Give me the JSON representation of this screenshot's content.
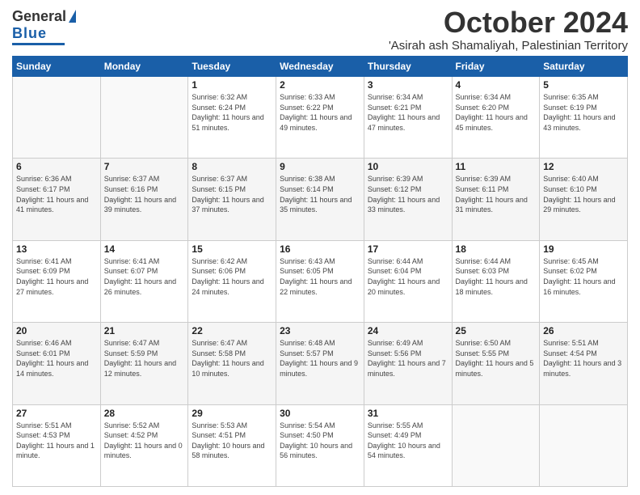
{
  "logo": {
    "line1": "General",
    "line2": "Blue"
  },
  "title": "October 2024",
  "location": "'Asirah ash Shamaliyah, Palestinian Territory",
  "days_of_week": [
    "Sunday",
    "Monday",
    "Tuesday",
    "Wednesday",
    "Thursday",
    "Friday",
    "Saturday"
  ],
  "weeks": [
    [
      {
        "day": "",
        "sunrise": "",
        "sunset": "",
        "daylight": ""
      },
      {
        "day": "",
        "sunrise": "",
        "sunset": "",
        "daylight": ""
      },
      {
        "day": "1",
        "sunrise": "Sunrise: 6:32 AM",
        "sunset": "Sunset: 6:24 PM",
        "daylight": "Daylight: 11 hours and 51 minutes."
      },
      {
        "day": "2",
        "sunrise": "Sunrise: 6:33 AM",
        "sunset": "Sunset: 6:22 PM",
        "daylight": "Daylight: 11 hours and 49 minutes."
      },
      {
        "day": "3",
        "sunrise": "Sunrise: 6:34 AM",
        "sunset": "Sunset: 6:21 PM",
        "daylight": "Daylight: 11 hours and 47 minutes."
      },
      {
        "day": "4",
        "sunrise": "Sunrise: 6:34 AM",
        "sunset": "Sunset: 6:20 PM",
        "daylight": "Daylight: 11 hours and 45 minutes."
      },
      {
        "day": "5",
        "sunrise": "Sunrise: 6:35 AM",
        "sunset": "Sunset: 6:19 PM",
        "daylight": "Daylight: 11 hours and 43 minutes."
      }
    ],
    [
      {
        "day": "6",
        "sunrise": "Sunrise: 6:36 AM",
        "sunset": "Sunset: 6:17 PM",
        "daylight": "Daylight: 11 hours and 41 minutes."
      },
      {
        "day": "7",
        "sunrise": "Sunrise: 6:37 AM",
        "sunset": "Sunset: 6:16 PM",
        "daylight": "Daylight: 11 hours and 39 minutes."
      },
      {
        "day": "8",
        "sunrise": "Sunrise: 6:37 AM",
        "sunset": "Sunset: 6:15 PM",
        "daylight": "Daylight: 11 hours and 37 minutes."
      },
      {
        "day": "9",
        "sunrise": "Sunrise: 6:38 AM",
        "sunset": "Sunset: 6:14 PM",
        "daylight": "Daylight: 11 hours and 35 minutes."
      },
      {
        "day": "10",
        "sunrise": "Sunrise: 6:39 AM",
        "sunset": "Sunset: 6:12 PM",
        "daylight": "Daylight: 11 hours and 33 minutes."
      },
      {
        "day": "11",
        "sunrise": "Sunrise: 6:39 AM",
        "sunset": "Sunset: 6:11 PM",
        "daylight": "Daylight: 11 hours and 31 minutes."
      },
      {
        "day": "12",
        "sunrise": "Sunrise: 6:40 AM",
        "sunset": "Sunset: 6:10 PM",
        "daylight": "Daylight: 11 hours and 29 minutes."
      }
    ],
    [
      {
        "day": "13",
        "sunrise": "Sunrise: 6:41 AM",
        "sunset": "Sunset: 6:09 PM",
        "daylight": "Daylight: 11 hours and 27 minutes."
      },
      {
        "day": "14",
        "sunrise": "Sunrise: 6:41 AM",
        "sunset": "Sunset: 6:07 PM",
        "daylight": "Daylight: 11 hours and 26 minutes."
      },
      {
        "day": "15",
        "sunrise": "Sunrise: 6:42 AM",
        "sunset": "Sunset: 6:06 PM",
        "daylight": "Daylight: 11 hours and 24 minutes."
      },
      {
        "day": "16",
        "sunrise": "Sunrise: 6:43 AM",
        "sunset": "Sunset: 6:05 PM",
        "daylight": "Daylight: 11 hours and 22 minutes."
      },
      {
        "day": "17",
        "sunrise": "Sunrise: 6:44 AM",
        "sunset": "Sunset: 6:04 PM",
        "daylight": "Daylight: 11 hours and 20 minutes."
      },
      {
        "day": "18",
        "sunrise": "Sunrise: 6:44 AM",
        "sunset": "Sunset: 6:03 PM",
        "daylight": "Daylight: 11 hours and 18 minutes."
      },
      {
        "day": "19",
        "sunrise": "Sunrise: 6:45 AM",
        "sunset": "Sunset: 6:02 PM",
        "daylight": "Daylight: 11 hours and 16 minutes."
      }
    ],
    [
      {
        "day": "20",
        "sunrise": "Sunrise: 6:46 AM",
        "sunset": "Sunset: 6:01 PM",
        "daylight": "Daylight: 11 hours and 14 minutes."
      },
      {
        "day": "21",
        "sunrise": "Sunrise: 6:47 AM",
        "sunset": "Sunset: 5:59 PM",
        "daylight": "Daylight: 11 hours and 12 minutes."
      },
      {
        "day": "22",
        "sunrise": "Sunrise: 6:47 AM",
        "sunset": "Sunset: 5:58 PM",
        "daylight": "Daylight: 11 hours and 10 minutes."
      },
      {
        "day": "23",
        "sunrise": "Sunrise: 6:48 AM",
        "sunset": "Sunset: 5:57 PM",
        "daylight": "Daylight: 11 hours and 9 minutes."
      },
      {
        "day": "24",
        "sunrise": "Sunrise: 6:49 AM",
        "sunset": "Sunset: 5:56 PM",
        "daylight": "Daylight: 11 hours and 7 minutes."
      },
      {
        "day": "25",
        "sunrise": "Sunrise: 6:50 AM",
        "sunset": "Sunset: 5:55 PM",
        "daylight": "Daylight: 11 hours and 5 minutes."
      },
      {
        "day": "26",
        "sunrise": "Sunrise: 5:51 AM",
        "sunset": "Sunset: 4:54 PM",
        "daylight": "Daylight: 11 hours and 3 minutes."
      }
    ],
    [
      {
        "day": "27",
        "sunrise": "Sunrise: 5:51 AM",
        "sunset": "Sunset: 4:53 PM",
        "daylight": "Daylight: 11 hours and 1 minute."
      },
      {
        "day": "28",
        "sunrise": "Sunrise: 5:52 AM",
        "sunset": "Sunset: 4:52 PM",
        "daylight": "Daylight: 11 hours and 0 minutes."
      },
      {
        "day": "29",
        "sunrise": "Sunrise: 5:53 AM",
        "sunset": "Sunset: 4:51 PM",
        "daylight": "Daylight: 10 hours and 58 minutes."
      },
      {
        "day": "30",
        "sunrise": "Sunrise: 5:54 AM",
        "sunset": "Sunset: 4:50 PM",
        "daylight": "Daylight: 10 hours and 56 minutes."
      },
      {
        "day": "31",
        "sunrise": "Sunrise: 5:55 AM",
        "sunset": "Sunset: 4:49 PM",
        "daylight": "Daylight: 10 hours and 54 minutes."
      },
      {
        "day": "",
        "sunrise": "",
        "sunset": "",
        "daylight": ""
      },
      {
        "day": "",
        "sunrise": "",
        "sunset": "",
        "daylight": ""
      }
    ]
  ]
}
